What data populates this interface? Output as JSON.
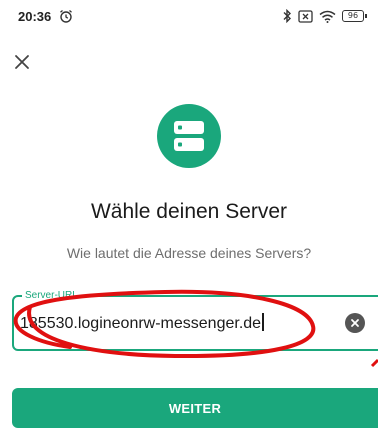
{
  "status_bar": {
    "time": "20:36",
    "icons": [
      "alarm-icon",
      "bluetooth-icon",
      "sim-icon",
      "wifi-icon",
      "battery-icon"
    ],
    "battery": "96"
  },
  "header": {
    "close_icon": "close-icon"
  },
  "logo": {
    "icon": "server-icon",
    "color": "#1aa77c"
  },
  "title": "Wähle deinen Server",
  "subtitle": "Wie lautet die Adresse deines Servers?",
  "server_field": {
    "label": "Server-URL",
    "value": "185530.logineonrw-messenger.de",
    "clear_icon": "clear-icon"
  },
  "continue_button": {
    "label": "WEITER"
  },
  "colors": {
    "accent": "#1aa77c",
    "annotation": "#e01010"
  }
}
